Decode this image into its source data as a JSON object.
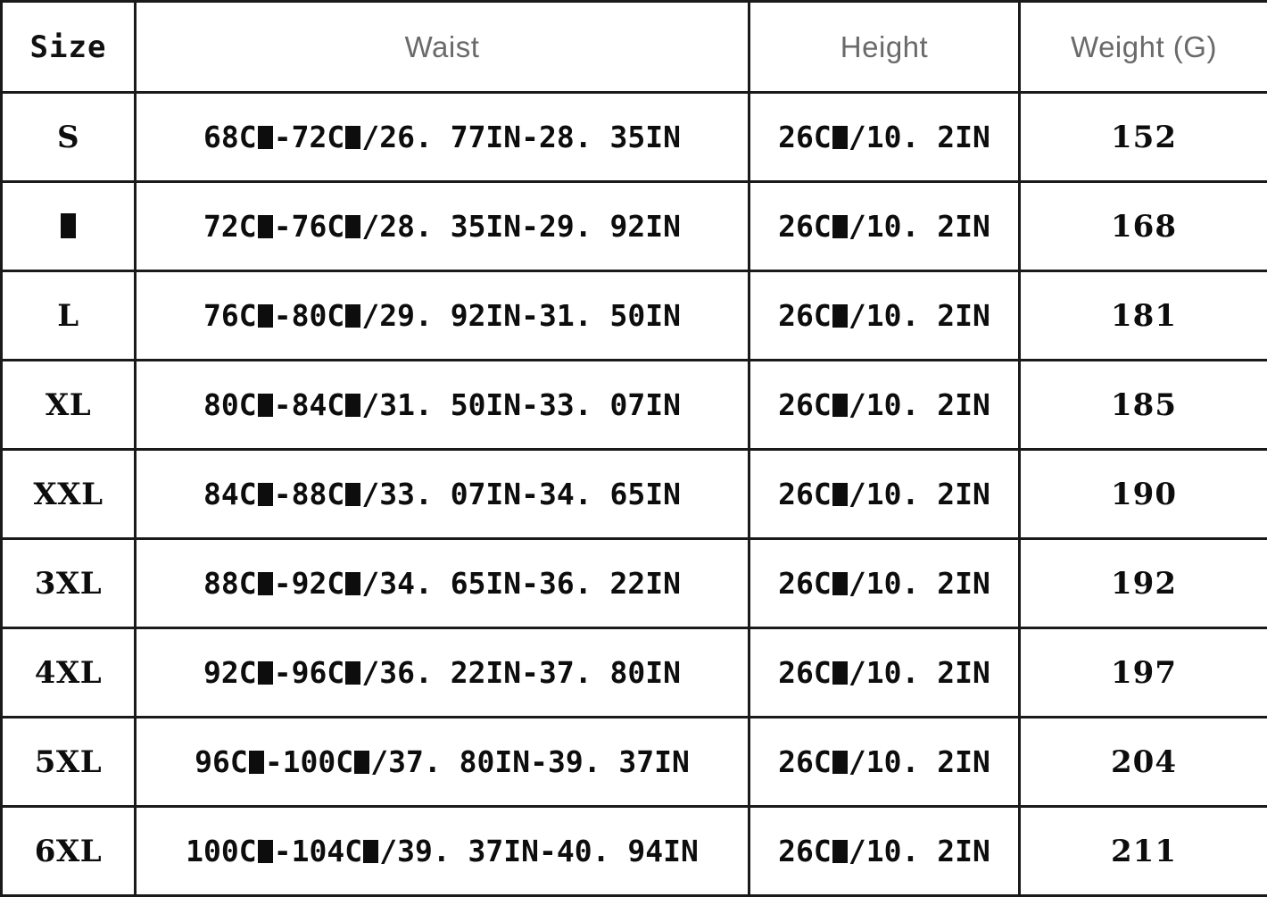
{
  "table": {
    "missing_glyph_char": "M",
    "missing_glyph_note": "tofu-box",
    "ink_color": "#0d0d0d",
    "header_muted_color": "#6a6a6a",
    "border_color": "#1a1a1a",
    "headers": {
      "size": "Size",
      "waist": "Waist",
      "height": "Height",
      "weight": "Weight (G)"
    },
    "rows": [
      {
        "size": "S",
        "waist_prefix": "68C",
        "waist_mid": "-72C",
        "waist_suffix": "/26. 77IN-28. 35IN",
        "height_prefix": "26C",
        "height_suffix": "/10. 2IN",
        "weight": "152"
      },
      {
        "size": "",
        "size_is_tofu": true,
        "waist_prefix": "72C",
        "waist_mid": "-76C",
        "waist_suffix": "/28. 35IN-29. 92IN",
        "height_prefix": "26C",
        "height_suffix": "/10. 2IN",
        "weight": "168"
      },
      {
        "size": "L",
        "waist_prefix": "76C",
        "waist_mid": "-80C",
        "waist_suffix": "/29. 92IN-31. 50IN",
        "height_prefix": "26C",
        "height_suffix": "/10. 2IN",
        "weight": "181"
      },
      {
        "size": "XL",
        "waist_prefix": "80C",
        "waist_mid": "-84C",
        "waist_suffix": "/31. 50IN-33. 07IN",
        "height_prefix": "26C",
        "height_suffix": "/10. 2IN",
        "weight": "185"
      },
      {
        "size": "XXL",
        "waist_prefix": "84C",
        "waist_mid": "-88C",
        "waist_suffix": "/33. 07IN-34. 65IN",
        "height_prefix": "26C",
        "height_suffix": "/10. 2IN",
        "weight": "190"
      },
      {
        "size": "3XL",
        "waist_prefix": "88C",
        "waist_mid": "-92C",
        "waist_suffix": "/34. 65IN-36. 22IN",
        "height_prefix": "26C",
        "height_suffix": "/10. 2IN",
        "weight": "192"
      },
      {
        "size": "4XL",
        "waist_prefix": "92C",
        "waist_mid": "-96C",
        "waist_suffix": "/36. 22IN-37. 80IN",
        "height_prefix": "26C",
        "height_suffix": "/10. 2IN",
        "weight": "197"
      },
      {
        "size": "5XL",
        "waist_prefix": "96C",
        "waist_mid": "-100C",
        "waist_suffix": "/37. 80IN-39. 37IN",
        "height_prefix": "26C",
        "height_suffix": "/10. 2IN",
        "weight": "204"
      },
      {
        "size": "6XL",
        "waist_prefix": "100C",
        "waist_mid": "-104C",
        "waist_suffix": "/39. 37IN-40. 94IN",
        "height_prefix": "26C",
        "height_suffix": "/10. 2IN",
        "weight": "211"
      }
    ]
  }
}
